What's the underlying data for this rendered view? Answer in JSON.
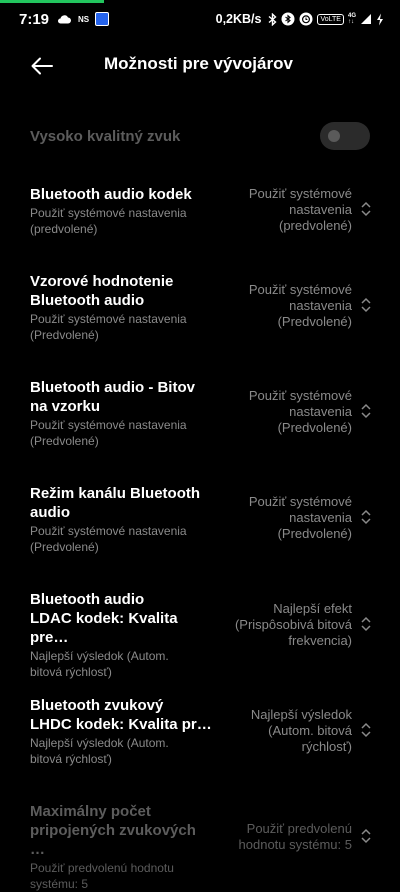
{
  "status_bar": {
    "time": "7:19",
    "ns_label": "NS",
    "net_speed": "0,2KB/s",
    "vowifi_label": "VoLTE",
    "net_top": "4G",
    "net_bottom": "↑↓"
  },
  "header": {
    "title": "Možnosti pre vývojárov"
  },
  "settings": [
    {
      "title": "Vysoko kvalitný zvuk",
      "toggle_on": false,
      "disabled": true
    },
    {
      "title": "Bluetooth audio kodek",
      "subtitle": "Použiť systémové nastavenia\n(predvolené)",
      "value": "Použiť systémové\nnastavenia\n(predvolené)"
    },
    {
      "title": "Vzorové hodnotenie\nBluetooth audio",
      "subtitle": "Použiť systémové nastavenia\n(Predvolené)",
      "value": "Použiť systémové\nnastavenia\n(Predvolené)"
    },
    {
      "title": "Bluetooth audio - Bitov\nna vzorku",
      "subtitle": "Použiť systémové nastavenia\n(Predvolené)",
      "value": "Použiť systémové\nnastavenia\n(Predvolené)"
    },
    {
      "title": "Režim kanálu Bluetooth\naudio",
      "subtitle": "Použiť systémové nastavenia\n(Predvolené)",
      "value": "Použiť systémové\nnastavenia\n(Predvolené)"
    },
    {
      "title": "Bluetooth audio\nLDAC kodek: Kvalita pre…",
      "subtitle": "Najlepší výsledok (Autom.\nbitová rýchlosť)",
      "value": "Najlepší efekt\n(Prispôsobivá bitová\nfrekvencia)"
    },
    {
      "title": "Bluetooth zvukový\nLHDC kodek: Kvalita pr…",
      "subtitle": "Najlepší výsledok (Autom.\nbitová rýchlosť)",
      "value": "Najlepší výsledok\n(Autom. bitová\nrýchlosť)"
    },
    {
      "title": "Maximálny počet\npripojených zvukových …",
      "subtitle": "Použiť predvolenú hodnotu\nsystému: 5",
      "value": "Použiť predvolenú\nhodnotu systému: 5",
      "disabled": true
    }
  ],
  "colors": {
    "accent_progress": "#22c55e",
    "text_primary": "#ffffff",
    "text_secondary": "#8a8a8a",
    "text_disabled": "#5c5c5c"
  },
  "progress_fraction": 0.26
}
